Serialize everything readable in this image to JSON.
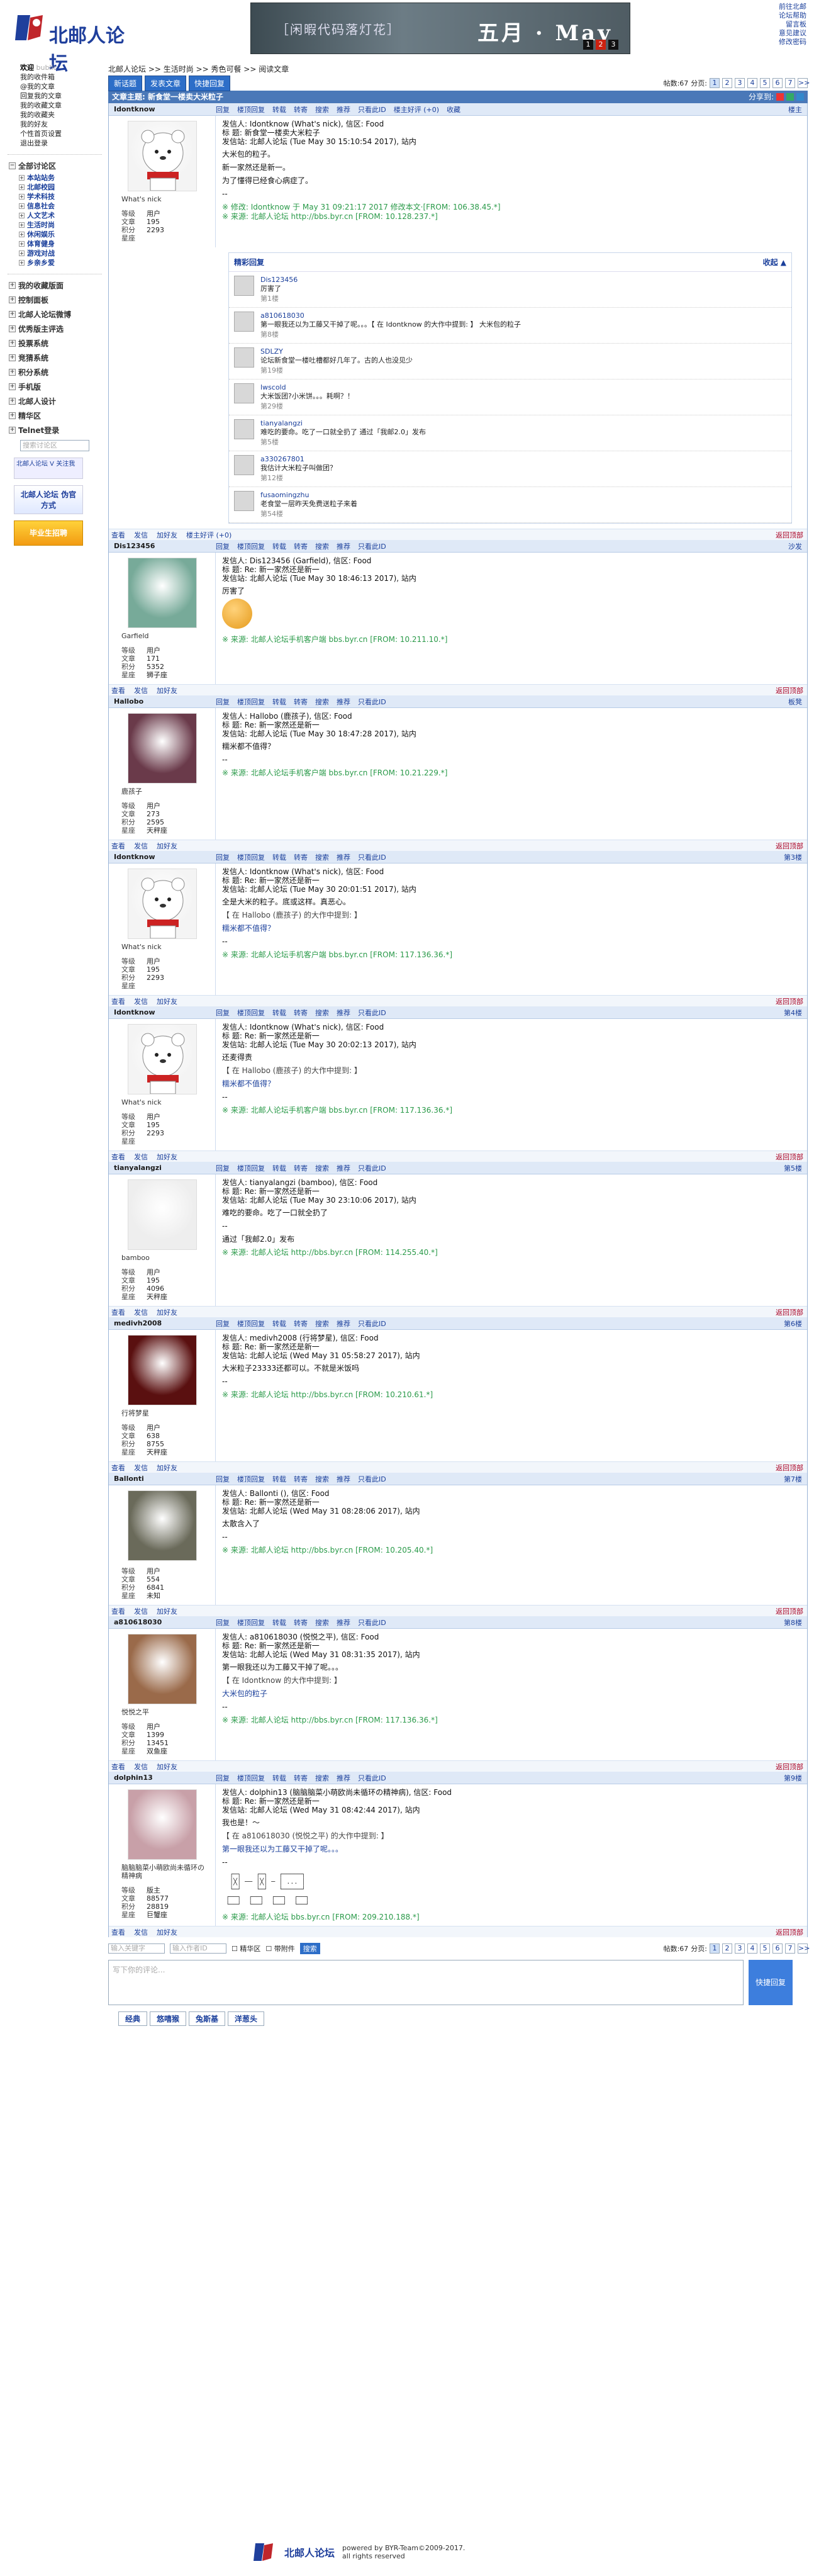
{
  "site": {
    "logo_text": "北邮人论坛",
    "banner_left": "［闲暇代码落灯花］",
    "banner_right": "五月 · May",
    "banner_dots": [
      "1",
      "2",
      "3"
    ]
  },
  "toplinks": [
    "前往北邮",
    "论坛帮助",
    "留言板",
    "意见建议",
    "修改密码"
  ],
  "sidebar": {
    "welcome": "欢迎",
    "username": "bublic",
    "user_links": [
      "我的收件箱",
      "@我的文章",
      "回复我的文章",
      "我的收藏文章",
      "我的收藏夹",
      "我的好友",
      "个性首页设置",
      "退出登录"
    ],
    "sections_label": "全部讨论区",
    "boards": [
      "本站站务",
      "北邮校园",
      "学术科技",
      "信息社会",
      "人文艺术",
      "生活时尚",
      "休闲娱乐",
      "体育健身",
      "游戏对战",
      "乡亲乡爱"
    ],
    "menu": [
      "我的收藏版面",
      "控制面板",
      "北邮人论坛微博",
      "优秀版主评选",
      "投票系统",
      "竞猜系统",
      "积分系统",
      "手机版",
      "北邮人设计",
      "精华区",
      "Telnet登录"
    ],
    "search_placeholder": "搜索讨论区",
    "ad1": "北邮人论坛 V 关注我",
    "ad2": "北邮人论坛 伪官方式",
    "ad3": "毕业生招聘"
  },
  "main": {
    "breadcrumb": "北邮人论坛 >> 生活时尚 >> 秀色可餐 >> 阅读文章",
    "buttons": [
      "新话题",
      "发表文章",
      "快捷回复"
    ],
    "post_count": "帖数:67",
    "pages_label": "分页:",
    "pages": [
      "1",
      "2",
      "3",
      "4",
      "5",
      "6",
      "7",
      ">>"
    ],
    "topic_title": "文章主题: 新食堂一楼卖大米粒子",
    "share_label": "分享到:",
    "actions": [
      "回复",
      "楼顶回复",
      "转载",
      "转寄",
      "搜索",
      "推荐",
      "只看此ID",
      "楼主好评 (+0)",
      "收藏"
    ]
  },
  "posts": [
    {
      "user": "Idontknow",
      "floor": "楼主",
      "nick": "What's nick",
      "level": "用户",
      "articles": "195",
      "points": "2293",
      "star": "",
      "header": [
        "发信人: Idontknow (What's nick), 信区: Food",
        "标 题: 新食堂一楼卖大米粒子",
        "发信站: 北邮人论坛 (Tue May 30 15:10:54 2017), 站内"
      ],
      "lines": [
        "大米包的粒子。",
        "新一家然还是新一。",
        "为了懂得已经食心病症了。",
        "--"
      ],
      "src": "※ 修改: Idontknow 于 May 31 09:21:17 2017 修改本文·[FROM: 106.38.45.*]",
      "src2": "※ 来源: 北邮人论坛 http://bbs.byr.cn [FROM: 10.128.237.*]"
    },
    {
      "user": "Dis123456",
      "floor": "沙发",
      "nick": "Garfield",
      "level": "用户",
      "articles": "171",
      "points": "5352",
      "star": "狮子座",
      "header": [
        "发信人: Dis123456 (Garfield), 信区: Food",
        "标 题: Re: 新一家然还是新一",
        "发信站: 北邮人论坛 (Tue May 30 18:46:13 2017), 站内"
      ],
      "lines": [
        "厉害了"
      ],
      "src": "※ 来源: 北邮人论坛手机客户端 bbs.byr.cn [FROM: 10.211.10.*]",
      "src2": ""
    },
    {
      "user": "Hallobo",
      "floor": "板凳",
      "nick": "鹿孩子",
      "level": "用户",
      "articles": "273",
      "points": "2595",
      "star": "天秤座",
      "header": [
        "发信人: Hallobo (鹿孩子), 信区: Food",
        "标 题: Re: 新一家然还是新一",
        "发信站: 北邮人论坛 (Tue May 30 18:47:28 2017), 站内"
      ],
      "lines": [
        "糯米都不值得？",
        "--"
      ],
      "src": "※ 来源: 北邮人论坛手机客户端 bbs.byr.cn [FROM: 10.21.229.*]",
      "src2": ""
    },
    {
      "user": "Idontknow",
      "floor": "第3楼",
      "nick": "What's nick",
      "level": "用户",
      "articles": "195",
      "points": "2293",
      "star": "",
      "header": [
        "发信人: Idontknow (What's nick), 信区: Food",
        "标 题: Re: 新一家然还是新一",
        "发信站: 北邮人论坛 (Tue May 30 20:01:51 2017), 站内"
      ],
      "lines": [
        "全是大米的粒子。底或这样。真恶心。",
        "【 在 Hallobo (鹿孩子) 的大作中提到: 】",
        "糯米都不值得？",
        "--"
      ],
      "src": "※ 来源: 北邮人论坛手机客户端 bbs.byr.cn [FROM: 117.136.36.*]",
      "src2": ""
    },
    {
      "user": "Idontknow",
      "floor": "第4楼",
      "nick": "What's nick",
      "level": "用户",
      "articles": "195",
      "points": "2293",
      "star": "",
      "header": [
        "发信人: Idontknow (What's nick), 信区: Food",
        "标 题: Re: 新一家然还是新一",
        "发信站: 北邮人论坛 (Tue May 30 20:02:13 2017), 站内"
      ],
      "lines": [
        "还麦得责",
        "【 在 Hallobo (鹿孩子) 的大作中提到: 】",
        "糯米都不值得？",
        "--"
      ],
      "src": "※ 来源: 北邮人论坛手机客户端 bbs.byr.cn [FROM: 117.136.36.*]",
      "src2": ""
    },
    {
      "user": "tianyalangzi",
      "floor": "第5楼",
      "nick": "bamboo",
      "level": "用户",
      "articles": "195",
      "points": "4096",
      "star": "天秤座",
      "header": [
        "发信人: tianyalangzi (bamboo), 信区: Food",
        "标 题: Re: 新一家然还是新一",
        "发信站: 北邮人论坛 (Tue May 30 23:10:06 2017), 站内"
      ],
      "lines": [
        "难吃的要命。吃了一口就全扔了",
        "--",
        "通过「我邮2.0」发布"
      ],
      "src": "※ 来源: 北邮人论坛 http://bbs.byr.cn [FROM: 114.255.40.*]",
      "src2": ""
    },
    {
      "user": "medivh2008",
      "floor": "第6楼",
      "nick": "行将梦星",
      "level": "用户",
      "articles": "638",
      "points": "8755",
      "star": "天秤座",
      "header": [
        "发信人: medivh2008 (行将梦星), 信区: Food",
        "标 题: Re: 新一家然还是新一",
        "发信站: 北邮人论坛 (Wed May 31 05:58:27 2017), 站内"
      ],
      "lines": [
        "大米粒子23333还都可以。不就是米饭吗",
        "--"
      ],
      "src": "※ 来源: 北邮人论坛 http://bbs.byr.cn [FROM: 10.210.61.*]",
      "src2": ""
    },
    {
      "user": "Ballonti",
      "floor": "第7楼",
      "nick": "",
      "level": "用户",
      "articles": "554",
      "points": "6841",
      "star": "未知",
      "header": [
        "发信人: Ballonti (), 信区: Food",
        "标 题: Re: 新一家然还是新一",
        "发信站: 北邮人论坛 (Wed May 31 08:28:06 2017), 站内"
      ],
      "lines": [
        "太散含入了",
        "--"
      ],
      "src": "※ 来源: 北邮人论坛 http://bbs.byr.cn [FROM: 10.205.40.*]",
      "src2": ""
    },
    {
      "user": "a810618030",
      "floor": "第8楼",
      "nick": "悦悦之平",
      "level": "用户",
      "articles": "1399",
      "points": "13451",
      "star": "双鱼座",
      "header": [
        "发信人: a810618030 (悦悦之平), 信区: Food",
        "标 题: Re: 新一家然还是新一",
        "发信站: 北邮人论坛 (Wed May 31 08:31:35 2017), 站内"
      ],
      "lines": [
        "第一眼我还以为工藤又干掉了呢。。。",
        "【 在 Idontknow 的大作中提到: 】",
        "大米包的粒子",
        "--"
      ],
      "src": "※ 来源: 北邮人论坛 http://bbs.byr.cn [FROM: 117.136.36.*]",
      "src2": ""
    },
    {
      "user": "dolphin13",
      "floor": "第9楼",
      "nick": "脑脑脑菜小萌欧尚未循环の精神病",
      "level": "版主",
      "articles": "88577",
      "points": "28819",
      "star": "巨蟹座",
      "header": [
        "发信人: dolphin13 (脑脑脑菜小萌欧尚未循环の精神病), 信区: Food",
        "标 题: Re: 新一家然还是新一",
        "发信站: 北邮人论坛 (Wed May 31 08:42:44 2017), 站内"
      ],
      "lines": [
        "我也是！～",
        "【 在 a810618030 (悦悦之平) 的大作中提到: 】",
        "第一眼我还以为工藤又干掉了呢。。。",
        "--"
      ],
      "src": "※ 来源: 北邮人论坛 bbs.byr.cn [FROM: 209.210.188.*]",
      "src2": ""
    }
  ],
  "replies_box": {
    "title": "精彩回复",
    "collapse": "收起 ▲",
    "items": [
      {
        "name": "Dis123456",
        "text": "厉害了",
        "meta": "第1楼"
      },
      {
        "name": "a810618030",
        "text": "第一眼我还以为工藤又干掉了呢。。。【 在 Idontknow 的大作中提到: 】 大米包的粒子",
        "meta": "第8楼"
      },
      {
        "name": "SDLZY",
        "text": "论坛新食堂一楼吐槽都好几年了。古的人也没见少",
        "meta": "第19楼"
      },
      {
        "name": "lwscold",
        "text": "大米饭团?小米饼。。。耗啊？！",
        "meta": "第29楼"
      },
      {
        "name": "tianyalangzi",
        "text": "难吃的要命。吃了一口就全扔了 通过「我邮2.0」发布",
        "meta": "第5楼"
      },
      {
        "name": "a330267801",
        "text": "我估计大米粒子叫做团？",
        "meta": "第12楼"
      },
      {
        "name": "fusaomingzhu",
        "text": "老食堂一层昨天免费送粒子来着",
        "meta": "第54楼"
      }
    ]
  },
  "footer_actions": [
    "查看",
    "发信",
    "加好友",
    "楼主好评 (+0)"
  ],
  "back_top": "返回顶部",
  "bottom": {
    "search_placeholder1": "输入关键字",
    "search_placeholder2": "输入作者ID",
    "checkbox1": "精华区",
    "checkbox2": "带附件",
    "search_btn": "搜索",
    "reply_placeholder": "写下你的评论...",
    "submit": "快捷回复",
    "tabs": [
      "经典",
      "悠嘻猴",
      "兔斯基",
      "洋葱头"
    ]
  },
  "footer": {
    "logo": "北邮人论坛",
    "line1": "powered by BYR-Team©2009-2017.",
    "line2": "all rights reserved"
  }
}
